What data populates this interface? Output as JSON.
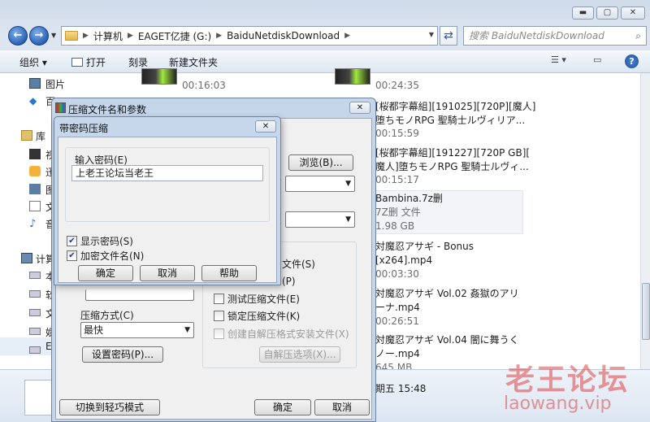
{
  "explorer": {
    "caption_buttons": {
      "minimize": "▬",
      "maximize": "▢",
      "close": "✕"
    },
    "breadcrumb": [
      "计算机",
      "EAGET亿捷 (G:)",
      "BaiduNetdiskDownload"
    ],
    "search_placeholder": "搜索 BaiduNetdiskDownload",
    "toolbar": {
      "organize": "组织 ▾",
      "open": "打开",
      "burn": "刻录",
      "new_folder": "新建文件夹",
      "help": "?"
    },
    "nav": {
      "pictures": "图片",
      "baidu": "百",
      "libraries": "库",
      "videos": "视",
      "thunder": "迅",
      "docs": "图",
      "text": "文",
      "music": "音",
      "computer": "计算",
      "local": "本",
      "soft": "软",
      "files": "文",
      "media": "娱",
      "eaget": "E"
    },
    "files": [
      {
        "name": "...",
        "sub": "00:16:03"
      },
      {
        "name": "...",
        "sub": "00:24:35"
      },
      {
        "name": "[桜都字幕組][191025][720P][魔人]",
        "name2": "堕ちモノRPG 聖騎士ルヴィリア...",
        "sub": "00:15:59"
      },
      {
        "name": "[桜都字幕組][191227][720P GB][",
        "name2": "魔人]堕ちモノRPG 聖騎士ルヴィ...",
        "sub": "00:15:17"
      },
      {
        "name": "Bambina.7z删",
        "name2": "7Z删 文件",
        "sub": "1.98 GB"
      },
      {
        "name": "対魔忍アサギ - Bonus",
        "name2": "[x264].mp4",
        "sub": "00:03:30"
      },
      {
        "name": "対魔忍アサギ Vol.02 姦獄のアリ",
        "name2": "ーナ.mp4",
        "sub": "00:26:51"
      },
      {
        "name": "対魔忍アサギ Vol.04 闇に舞うく",
        "name2": "ノー.mp4",
        "sub": "645 MB"
      }
    ],
    "status_date": "期五 15:48"
  },
  "archive_dialog": {
    "title": "压缩文件名和参数",
    "close": "✕",
    "browse": "浏览(B)...",
    "compress_method_label": "压缩方式(C)",
    "compress_method_value": "最快",
    "set_password": "设置密码(P)...",
    "options": {
      "lock_partial": "文件(S)",
      "p_partial": "(P)",
      "test": "测试压缩文件(E)",
      "lock": "锁定压缩文件(K)",
      "sfx": "创建自解压格式安装文件(X)",
      "sfx_options": "自解压选项(X)..."
    },
    "switch_mode": "切换到轻巧模式",
    "ok": "确定",
    "cancel": "取消"
  },
  "password_dialog": {
    "title": "带密码压缩",
    "close": "✕",
    "input_label": "输入密码(E)",
    "password_value": "上老王论坛当老王",
    "show_password": "显示密码(S)",
    "encrypt_names": "加密文件名(N)",
    "ok": "确定",
    "cancel": "取消",
    "help": "帮助"
  },
  "watermark": {
    "cn": "老王论坛",
    "url": "laowang.vip"
  }
}
